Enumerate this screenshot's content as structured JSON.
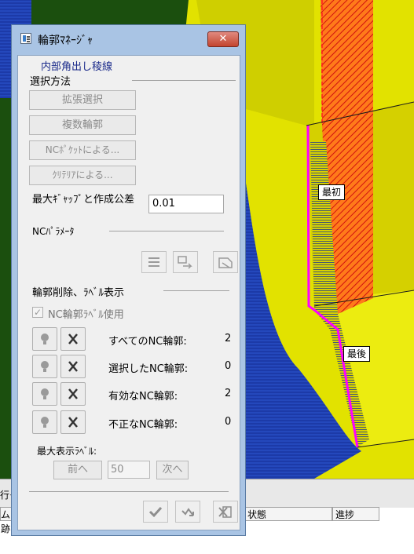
{
  "window": {
    "title": "輪郭ﾏﾈｰｼﾞｬ",
    "close_symbol": "✕"
  },
  "dialog": {
    "subtitle": "内部角出し稜線",
    "selection_group": {
      "title": "選択方法",
      "buttons": [
        "拡張選択",
        "複数輪郭",
        "NCﾎﾟｹｯﾄによる...",
        "ｸﾘﾃﾘｱによる..."
      ]
    },
    "gap": {
      "label": "最大ｷﾞｬｯﾌﾟと作成公差",
      "value": "0.01"
    },
    "nc_params": {
      "title": "NCﾊﾟﾗﾒｰﾀ"
    },
    "contour_group": {
      "title": "輪郭削除、ﾗﾍﾞﾙ表示",
      "checkbox_label": "NC輪郭ﾗﾍﾞﾙ使用",
      "checkbox_checked": true,
      "rows": [
        {
          "label": "すべてのNC輪郭:",
          "value": "2"
        },
        {
          "label": "選択したNC輪郭:",
          "value": "0"
        },
        {
          "label": "有効なNC輪郭:",
          "value": "2"
        },
        {
          "label": "不正なNC輪郭:",
          "value": "0"
        }
      ]
    },
    "max_labels": {
      "title": "最大表示ﾗﾍﾞﾙ:",
      "prev_label": "前へ",
      "value": "50",
      "next_label": "次へ"
    },
    "footer": {
      "ok_icon": "checkmark-icon",
      "apply_icon": "apply-arrow-icon",
      "cancel_icon": "cancel-icon"
    }
  },
  "viewport": {
    "labels": {
      "first": "最初",
      "last": "最後"
    },
    "colors": {
      "background": "#1b4f0e",
      "face_yellow": "#d9d900",
      "face_blue": "#1f3fa0",
      "edge_magenta": "#ff00ff",
      "hatch_red": "#e03010"
    }
  },
  "bottom": {
    "left_fragment_top": "行そ",
    "left_fragment": "ム跡",
    "col_status": "状態",
    "col_progress": "進捗"
  }
}
